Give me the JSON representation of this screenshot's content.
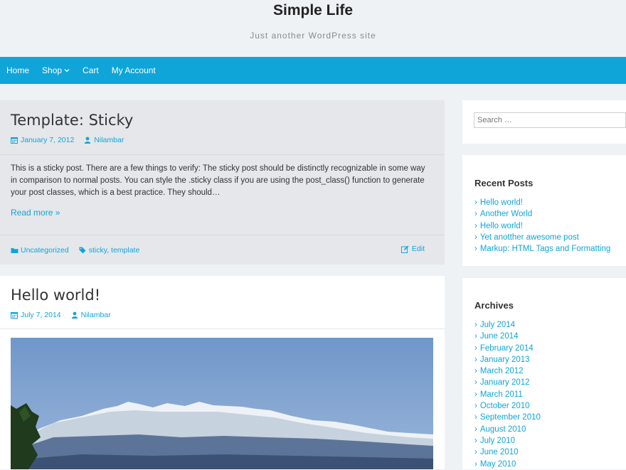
{
  "site": {
    "title": "Simple Life",
    "description": "Just another WordPress site"
  },
  "nav": {
    "items": [
      "Home",
      "Shop",
      "Cart",
      "My Account"
    ]
  },
  "posts": [
    {
      "title": "Template: Sticky",
      "date": "January 7, 2012",
      "author": "Nilambar",
      "excerpt": "This is a sticky post. There are a few things to verify: The sticky post should be distinctly recognizable in some way in comparison to normal posts. You can style the .sticky class if you are using the post_class() function to generate your post classes, which is a best practice. They should…",
      "read_more": "Read more »",
      "category": "Uncategorized",
      "tags": "sticky, template",
      "edit": "Edit"
    },
    {
      "title": "Hello world!",
      "date": "July 7, 2014",
      "author": "Nilambar"
    }
  ],
  "sidebar": {
    "search_placeholder": "Search …",
    "recent_title": "Recent Posts",
    "recent": [
      "Hello world!",
      "Another World",
      "Hello world!",
      "Yet anotther awesome post",
      "Markup: HTML Tags and Formatting"
    ],
    "archives_title": "Archives",
    "archives": [
      "July 2014",
      "June 2014",
      "February 2014",
      "January 2013",
      "March 2012",
      "January 2012",
      "March 2011",
      "October 2010",
      "September 2010",
      "August 2010",
      "July 2010",
      "June 2010",
      "May 2010"
    ]
  },
  "colors": {
    "accent": "#0fa5d9",
    "page_bg": "#eef2f5",
    "sticky_bg": "#e5e7ea"
  }
}
